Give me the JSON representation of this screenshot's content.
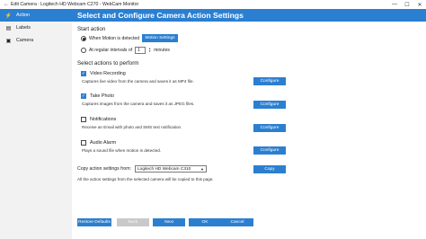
{
  "window": {
    "title": "Edit Camera : Logitech HD Webcam C270 - WebCam Monitor",
    "minimize": "—",
    "maximize": "☐",
    "close": "✕"
  },
  "sidebar": {
    "items": [
      {
        "label": "Action",
        "icon": "lightning-icon",
        "glyph": "⚡",
        "active": true
      },
      {
        "label": "Labels",
        "icon": "labels-icon",
        "glyph": "▤",
        "active": false
      },
      {
        "label": "Camera",
        "icon": "camera-icon",
        "glyph": "▣",
        "active": false
      }
    ]
  },
  "header": {
    "title": "Select and Configure Camera Action Settings"
  },
  "start_action": {
    "title": "Start action",
    "option_motion": "When Motion is detected",
    "motion_settings_btn": "Motion Settings",
    "option_interval": "At regular intervals of",
    "interval_value": "1",
    "interval_unit": "minutes",
    "selected": "motion"
  },
  "actions": {
    "title": "Select actions to perform",
    "configure_label": "Configure",
    "items": [
      {
        "name": "Video Recording",
        "desc": "Captures live video from the camera and saves it as MP4 file.",
        "checked": true
      },
      {
        "name": "Take Photo",
        "desc": "Captures images from the camera and saves it as JPEG files.",
        "checked": true
      },
      {
        "name": "Notifications",
        "desc": "Receive an Email with photo and SMS text notification.",
        "checked": false
      },
      {
        "name": "Audio Alarm",
        "desc": "Plays a sound file when motion is detected.",
        "checked": false
      }
    ]
  },
  "copy": {
    "label": "Copy action settings from:",
    "selected": "Logitech HD Webcam C310",
    "button": "Copy",
    "note": "All the action settings from the selected camera will be copied to this page."
  },
  "footer": {
    "restore": "Restore Defaults",
    "back": "Back",
    "next": "Next",
    "ok": "OK",
    "cancel": "Cancel"
  }
}
